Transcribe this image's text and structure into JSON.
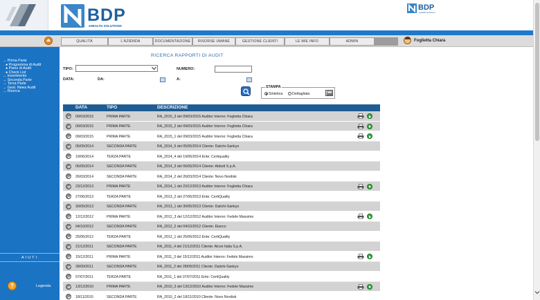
{
  "header": {
    "logo_text": "BDP",
    "logo_tagline": "eHEALTH SOLUTIONS",
    "logo_small_text": "BDP",
    "logo_small_tagline": "eHealth Solutions"
  },
  "nav": {
    "items": [
      "QUALITÀ",
      "L'AZIENDA",
      "DOCUMENTAZIONE",
      "RISORSE UMANE",
      "GESTIONE CLIENTI",
      "LE MIE INFO",
      "ADMIN"
    ],
    "user_name": "Foglietta Chiara"
  },
  "sidebar": {
    "items": [
      {
        "label": "→ Prima Parte",
        "sub": false
      },
      {
        "label": "● Programma di Audit",
        "sub": true
      },
      {
        "label": "● Piano di Audit",
        "sub": true
      },
      {
        "label": "● Check List",
        "sub": true
      },
      {
        "label": "→ Inserimento",
        "sub": false
      },
      {
        "label": "→ Seconda Parte",
        "sub": false
      },
      {
        "label": "→ Terza Parte",
        "sub": false
      },
      {
        "label": "→ Gest. News Audit",
        "sub": false
      },
      {
        "label": "→ Ricerca",
        "sub": false
      }
    ],
    "aiuti_label": "AIUTI",
    "legenda_label": "Legenda",
    "legenda_icon_glyph": "?"
  },
  "form": {
    "title": "RICERCA RAPPORTI DI AUDIT",
    "tipo_label": "TIPO:",
    "tipo_value": "",
    "numero_label": "NUMERO:",
    "numero_value": "",
    "data_label": "DATA:",
    "da_label": "DA:",
    "a_label": "A:",
    "stampa_label": "STAMPA",
    "radio_sintetica": "Sintetica",
    "radio_dettagliata": "Dettagliata",
    "selected_stampa": "Sintetica"
  },
  "table": {
    "columns": [
      "DATA",
      "TIPO",
      "DESCRIZIONE"
    ],
    "rows": [
      {
        "data": "09/03/2015",
        "tipo": "PRIMA PARTE",
        "descrizione": "RA_2015_3 del 09/03/2015 Auditor Interno: Foglietta Chiara",
        "actions": true,
        "shade": "alt"
      },
      {
        "data": "09/03/2015",
        "tipo": "PRIMA PARTE",
        "descrizione": "RA_2015_2 del 09/03/2015 Auditor Interno: Foglietta Chiara",
        "actions": true,
        "shade": "alt"
      },
      {
        "data": "09/03/2015",
        "tipo": "PRIMA PARTE",
        "descrizione": "RA_2015_1 del 09/03/2015 Auditor Interno: Foglietta Chiara",
        "actions": true,
        "shade": "plain"
      },
      {
        "data": "05/05/2014",
        "tipo": "SECONDA PARTE",
        "descrizione": "RA_2014_5 del 05/05/2014 Cliente: Daiichi-Sankyo",
        "actions": false,
        "shade": "alt"
      },
      {
        "data": "19/06/2014",
        "tipo": "TERZA PARTE",
        "descrizione": "RA_2014_4 del 19/06/2014 Ente: Certiquality",
        "actions": false,
        "shade": "plain"
      },
      {
        "data": "06/05/2014",
        "tipo": "SECONDA PARTE",
        "descrizione": "RA_2014_3 del 06/05/2014 Cliente: Abbott S.p.A.",
        "actions": false,
        "shade": "alt"
      },
      {
        "data": "26/03/2014",
        "tipo": "SECONDA PARTE",
        "descrizione": "RA_2014_2 del 26/03/2014 Cliente: Novo Nordisk",
        "actions": false,
        "shade": "plain"
      },
      {
        "data": "23/12/2013",
        "tipo": "PRIMA PARTE",
        "descrizione": "RA_2014_1 del 23/12/2013 Auditor Interno: Foglietta Chiara",
        "actions": true,
        "shade": "alt"
      },
      {
        "data": "27/06/2013",
        "tipo": "TERZA PARTE",
        "descrizione": "RA_2013_2 del 27/06/2013 Ente: CertiQuality",
        "actions": false,
        "shade": "plain"
      },
      {
        "data": "30/05/2013",
        "tipo": "SECONDA PARTE",
        "descrizione": "RA_2013_1 del 30/05/2013 Cliente: Daiichi-Sankyo",
        "actions": false,
        "shade": "alt"
      },
      {
        "data": "12/12/2012",
        "tipo": "PRIMA PARTE",
        "descrizione": "RA_2012_3 del 12/12/2012 Auditor Interno: Fedele Massimo",
        "actions": true,
        "shade": "plain"
      },
      {
        "data": "04/10/2012",
        "tipo": "SECONDA PARTE",
        "descrizione": "RA_2012_2 del 04/10/2012 Cliente: Elanco",
        "actions": false,
        "shade": "alt"
      },
      {
        "data": "25/06/2012",
        "tipo": "TERZA PARTE",
        "descrizione": "RA_2012_1 del 25/06/2012 Ente: CertiQuality",
        "actions": false,
        "shade": "plain"
      },
      {
        "data": "21/12/2011",
        "tipo": "SECONDA PARTE",
        "descrizione": "RA_2011_4 del 21/12/2011 Cliente: Alcon Italia S.p.A.",
        "actions": false,
        "shade": "alt"
      },
      {
        "data": "15/12/2011",
        "tipo": "PRIMA PARTE",
        "descrizione": "RA_2011_3 del 15/12/2011 Auditor Interno: Fedele Massimo",
        "actions": true,
        "shade": "plain"
      },
      {
        "data": "28/09/2011",
        "tipo": "SECONDA PARTE",
        "descrizione": "RA_2011_2 del 28/09/2011 Cliente: Daiichi-Sankyo",
        "actions": false,
        "shade": "alt"
      },
      {
        "data": "07/07/2011",
        "tipo": "TERZA PARTE",
        "descrizione": "RA_2011_1 del 07/07/2011 Ente: CertiQuality",
        "actions": false,
        "shade": "plain"
      },
      {
        "data": "13/12/2010",
        "tipo": "PRIMA PARTE",
        "descrizione": "RA_2010_3 del 13/12/2010 Auditor Interno: Fedele Massimo",
        "actions": true,
        "shade": "alt"
      },
      {
        "data": "18/11/2010",
        "tipo": "SECONDA PARTE",
        "descrizione": "RA_2010_2 del 18/11/2010 Cliente: Novo Nordisk",
        "actions": false,
        "shade": "plain"
      }
    ]
  },
  "colors": {
    "brand_blue": "#1f79c8",
    "sidebar_blue": "#1b73c4",
    "table_header": "#1f5c93",
    "row_shade": "#d3d3d3",
    "go_green": "#3aa845"
  },
  "icons": [
    "home-icon",
    "user-avatar-icon",
    "calendar-icon",
    "search-icon",
    "print-icon",
    "row-select-icon",
    "printer-icon",
    "go-arrow-icon",
    "help-icon"
  ]
}
